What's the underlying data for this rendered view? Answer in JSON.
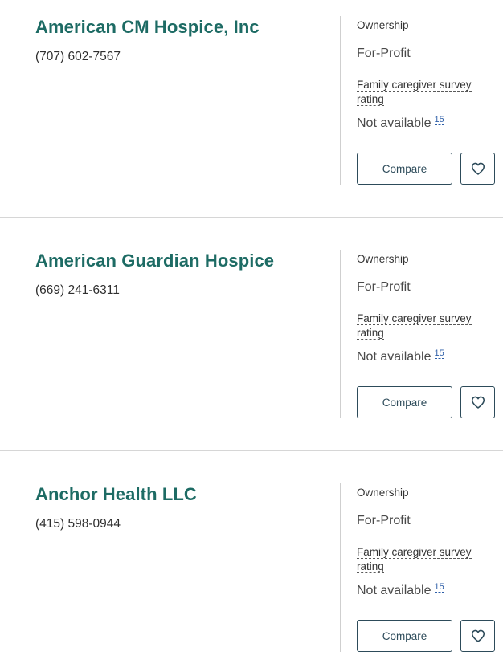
{
  "labels": {
    "ownership": "Ownership",
    "survey": "Family caregiver survey rating",
    "compare": "Compare",
    "footnote": "15"
  },
  "providers": [
    {
      "name": "American CM Hospice, Inc",
      "phone": "(707) 602-7567",
      "ownership": "For-Profit",
      "survey_rating": "Not available"
    },
    {
      "name": "American Guardian Hospice",
      "phone": "(669) 241-6311",
      "ownership": "For-Profit",
      "survey_rating": "Not available"
    },
    {
      "name": "Anchor Health LLC",
      "phone": "(415) 598-0944",
      "ownership": "For-Profit",
      "survey_rating": "Not available"
    }
  ],
  "colors": {
    "provider_name": "#1d6b64",
    "button_border": "#2d4b5a",
    "footnote_link": "#2e5fa8"
  },
  "icons": {
    "favorite": "heart-outline-icon"
  }
}
